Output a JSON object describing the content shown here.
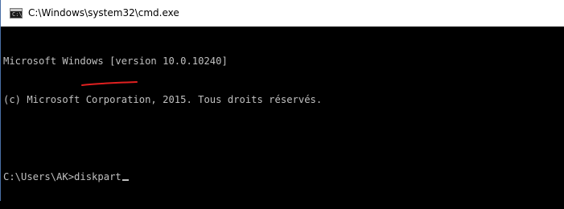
{
  "window": {
    "title": "C:\\Windows\\system32\\cmd.exe",
    "icon": "console-app-icon",
    "icon_glyph": "C:\\"
  },
  "console": {
    "lines": [
      "Microsoft Windows [version 10.0.10240]",
      "(c) Microsoft Corporation, 2015. Tous droits réservés.",
      "",
      "C:\\Users\\AK>diskpart"
    ],
    "text_color": "#c0c0c0",
    "background_color": "#000000"
  },
  "annotation": {
    "color": "#e02020",
    "type": "underline"
  }
}
